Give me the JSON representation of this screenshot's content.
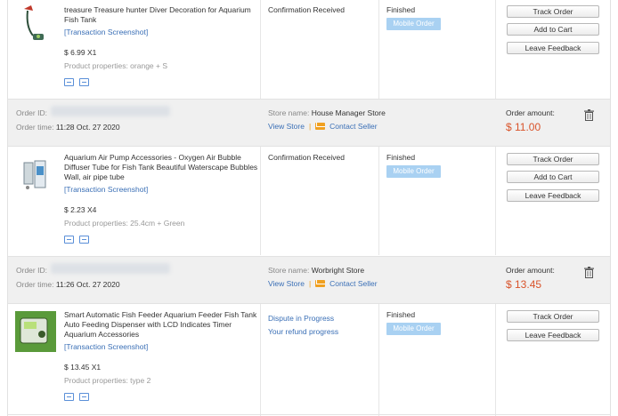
{
  "orders": [
    {
      "item": {
        "name": "treasure Treasure hunter Diver Decoration for Aquarium Fish Tank",
        "transaction": "[Transaction Screenshot]",
        "price": "$ 6.99 X1",
        "properties": "Product properties: orange + S",
        "status_line1": "Confirmation Received",
        "status_line2": "",
        "finished": "Finished",
        "badge": "Mobile Order",
        "buttons": [
          "Track Order",
          "Add to Cart",
          "Leave Feedback"
        ]
      }
    },
    {
      "header": {
        "order_id_label": "Order ID:",
        "order_time_label": "Order time:",
        "order_time": "11:28 Oct. 27 2020",
        "store_label": "Store name:",
        "store_name": "House Manager Store",
        "view_store": "View Store",
        "sep": "|",
        "contact": "Contact Seller",
        "amount_label": "Order amount:",
        "amount": "$ 11.00"
      },
      "item": {
        "name": "Aquarium Air Pump Accessories - Oxygen Air Bubble Diffuser Tube for Fish Tank Beautiful Waterscape Bubbles Wall, air pipe tube",
        "transaction": "[Transaction Screenshot]",
        "price": "$ 2.23 X4",
        "properties": "Product properties: 25.4cm + Green",
        "status_line1": "Confirmation Received",
        "status_line2": "",
        "finished": "Finished",
        "badge": "Mobile Order",
        "buttons": [
          "Track Order",
          "Add to Cart",
          "Leave Feedback"
        ]
      }
    },
    {
      "header": {
        "order_id_label": "Order ID:",
        "order_time_label": "Order time:",
        "order_time": "11:26 Oct. 27 2020",
        "store_label": "Store name:",
        "store_name": "Worbright Store",
        "view_store": "View Store",
        "sep": "|",
        "contact": "Contact Seller",
        "amount_label": "Order amount:",
        "amount": "$ 13.45"
      },
      "item": {
        "name": "Smart Automatic Fish Feeder Aquarium Feeder Fish Tank Auto Feeding Dispenser with LCD Indicates Timer Aquarium Accessories",
        "transaction": "[Transaction Screenshot]",
        "price": "$ 13.45 X1",
        "properties": "Product properties: type 2",
        "status_line1": "Dispute in Progress",
        "status_line2": "Your refund progress",
        "finished": "Finished",
        "badge": "Mobile Order",
        "buttons": [
          "Track Order",
          "Leave Feedback"
        ]
      }
    }
  ]
}
